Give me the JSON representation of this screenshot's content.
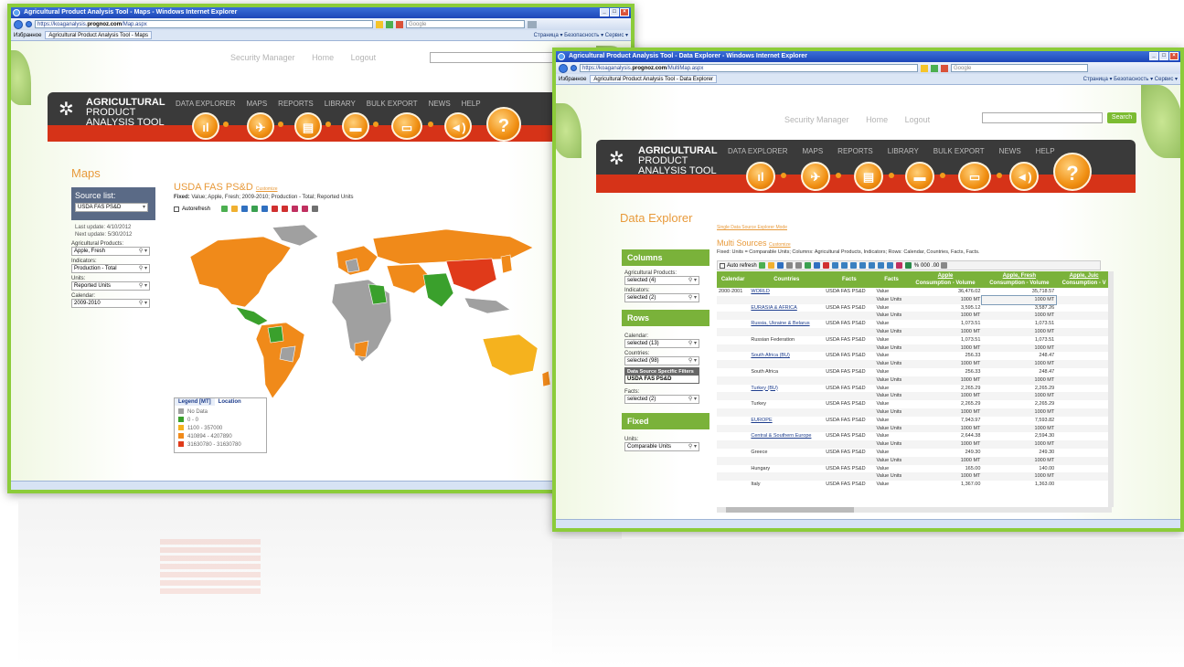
{
  "win1": {
    "title": "Agricultural Product Analysis Tool - Maps - Windows Internet Explorer",
    "url_prefix": "https://koaganalysis.",
    "url_bold": "prognoz.com",
    "url_suffix": "/Map.aspx",
    "search": "Google",
    "favorites": "Избранное",
    "tab": "Agricultural Product Analysis Tool - Maps",
    "ie_tools": "Страница ▾  Безопасность ▾  Сервис ▾",
    "top_links": [
      "Security Manager",
      "Home",
      "Logout"
    ],
    "logo_line1": "AGRICULTURAL",
    "logo_line2": "PRODUCT",
    "logo_line3": "ANALYSIS TOOL",
    "menu": [
      "DATA EXPLORER",
      "MAPS",
      "REPORTS",
      "LIBRARY",
      "BULK EXPORT",
      "NEWS",
      "HELP"
    ],
    "page_title": "Maps",
    "source_list_label": "Source list:",
    "source_value": "USDA FAS PS&D",
    "last_update": "Last update: 4/10/2012",
    "next_update": "Next update: 5/30/2012",
    "fields": [
      {
        "label": "Agricultural Products:",
        "value": "Apple, Fresh"
      },
      {
        "label": "Indicators:",
        "value": "Production - Total"
      },
      {
        "label": "Units:",
        "value": "Reported Units"
      },
      {
        "label": "Calendar:",
        "value": "2009-2010"
      }
    ],
    "map_title": "USDA FAS PS&D",
    "map_link": "Customize",
    "fixed_label": "Fixed:",
    "fixed_text": "Value; Apple, Fresh; 2009-2010; Production - Total; Reported Units",
    "autorefresh": "Autorefresh",
    "legend_tab1": "Legend [MT]",
    "legend_tab2": "Location",
    "legend": [
      {
        "label": "No Data",
        "color": "#a0a0a0"
      },
      {
        "label": "0 - 0",
        "color": "#3aa02c"
      },
      {
        "label": "1100 - 357000",
        "color": "#f5b21e"
      },
      {
        "label": "410894 - 4207890",
        "color": "#f08a1a"
      },
      {
        "label": "31630780 - 31630780",
        "color": "#e03a1a"
      }
    ]
  },
  "win2": {
    "title": "Agricultural Product Analysis Tool - Data Explorer - Windows Internet Explorer",
    "url_prefix": "https://koaganalysis.",
    "url_bold": "prognoz.com",
    "url_suffix": "/MultiMap.aspx",
    "search": "Google",
    "favorites": "Избранное",
    "tab": "Agricultural Product Analysis Tool - Data Explorer",
    "ie_tools": "Страница ▾  Безопасность ▾  Сервис ▾",
    "top_links": [
      "Security Manager",
      "Home",
      "Logout"
    ],
    "search_btn": "Search",
    "page_title": "Data Explorer",
    "breadcrumb": "Single Data Source Explorer Mode",
    "multi_title": "Multi Sources",
    "multi_link": "Customize",
    "fixed_line": "Fixed: Units = Comparable Units; Columns: Agricultural Products, Indicators; Rows: Calendar, Countries, Facts, Facts.",
    "auto_refresh": "Auto refresh",
    "columns_head": "Columns",
    "rows_head": "Rows",
    "fixed_head": "Fixed",
    "col_fields": [
      {
        "label": "Agricultural Products:",
        "value": "selected (4)"
      },
      {
        "label": "Indicators:",
        "value": "selected (2)"
      }
    ],
    "row_fields": [
      {
        "label": "Calendar:",
        "value": "selected (13)"
      },
      {
        "label": "Countries:",
        "value": "selected (98)"
      }
    ],
    "ds_filter_head": "Data Source Specific Filters",
    "ds_filter_item": "USDA FAS PS&D",
    "facts_field": {
      "label": "Facts:",
      "value": "selected (2)"
    },
    "fixed_field": {
      "label": "Units:",
      "value": "Comparable Units"
    },
    "table": {
      "headers": [
        "Calendar",
        "Countries",
        "Facts",
        "Facts",
        "Apple\nConsumption - Volume",
        "Apple, Fresh\nConsumption - Volume",
        "Apple, Juic\nConsumption - V"
      ],
      "rows": [
        [
          "2000-2001",
          "WORLD",
          "USDA FAS PS&D",
          "Value",
          "36,476.02",
          "35,718.57"
        ],
        [
          "",
          "",
          "",
          "Value Units",
          "1000 MT",
          "1000 MT"
        ],
        [
          "",
          "EURASIA & AFRICA",
          "USDA FAS PS&D",
          "Value",
          "3,595.12",
          "3,587.26"
        ],
        [
          "",
          "",
          "",
          "Value Units",
          "1000 MT",
          "1000 MT"
        ],
        [
          "",
          "Russia, Ukraine & Belarus",
          "USDA FAS PS&D",
          "Value",
          "1,073.51",
          "1,073.51"
        ],
        [
          "",
          "",
          "",
          "Value Units",
          "1000 MT",
          "1000 MT"
        ],
        [
          "",
          "Russian Federation",
          "USDA FAS PS&D",
          "Value",
          "1,073.51",
          "1,073.51"
        ],
        [
          "",
          "",
          "",
          "Value Units",
          "1000 MT",
          "1000 MT"
        ],
        [
          "",
          "South Africa (BU)",
          "USDA FAS PS&D",
          "Value",
          "256.33",
          "248.47"
        ],
        [
          "",
          "",
          "",
          "Value Units",
          "1000 MT",
          "1000 MT"
        ],
        [
          "",
          "South Africa",
          "USDA FAS PS&D",
          "Value",
          "256.33",
          "248.47"
        ],
        [
          "",
          "",
          "",
          "Value Units",
          "1000 MT",
          "1000 MT"
        ],
        [
          "",
          "Turkey (BU)",
          "USDA FAS PS&D",
          "Value",
          "2,265.29",
          "2,265.29"
        ],
        [
          "",
          "",
          "",
          "Value Units",
          "1000 MT",
          "1000 MT"
        ],
        [
          "",
          "Turkey",
          "USDA FAS PS&D",
          "Value",
          "2,265.29",
          "2,265.29"
        ],
        [
          "",
          "",
          "",
          "Value Units",
          "1000 MT",
          "1000 MT"
        ],
        [
          "",
          "EUROPE",
          "USDA FAS PS&D",
          "Value",
          "7,943.97",
          "7,593.82"
        ],
        [
          "",
          "",
          "",
          "Value Units",
          "1000 MT",
          "1000 MT"
        ],
        [
          "",
          "Central & Southern Europe",
          "USDA FAS PS&D",
          "Value",
          "2,644.38",
          "2,594.30"
        ],
        [
          "",
          "",
          "",
          "Value Units",
          "1000 MT",
          "1000 MT"
        ],
        [
          "",
          "Greece",
          "USDA FAS PS&D",
          "Value",
          "249.30",
          "249.30"
        ],
        [
          "",
          "",
          "",
          "Value Units",
          "1000 MT",
          "1000 MT"
        ],
        [
          "",
          "Hungary",
          "USDA FAS PS&D",
          "Value",
          "165.00",
          "140.00"
        ],
        [
          "",
          "",
          "",
          "Value Units",
          "1000 MT",
          "1000 MT"
        ],
        [
          "",
          "Italy",
          "USDA FAS PS&D",
          "Value",
          "1,367.00",
          "1,363.00"
        ]
      ],
      "links": [
        "WORLD",
        "EURASIA & AFRICA",
        "Russia, Ukraine & Belarus",
        "South Africa (BU)",
        "Turkey (BU)",
        "EUROPE",
        "Central & Southern Europe"
      ]
    }
  },
  "colors": {
    "accent": "#7ab23a",
    "frame": "#8ccc3a",
    "header": "#3a3a3a",
    "red": "#d63318",
    "orange": "#f29b1c"
  }
}
